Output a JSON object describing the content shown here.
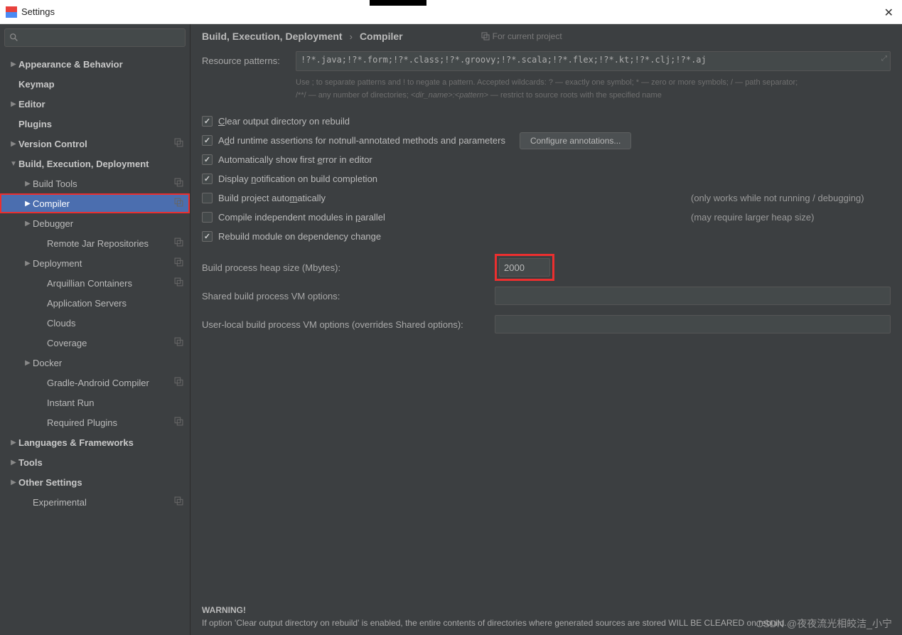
{
  "window": {
    "title": "Settings"
  },
  "sidebar": {
    "search_placeholder": "",
    "items": [
      {
        "label": "Appearance & Behavior",
        "depth": 0,
        "arrow": "▶",
        "bold": true
      },
      {
        "label": "Keymap",
        "depth": 0,
        "arrow": "",
        "bold": true
      },
      {
        "label": "Editor",
        "depth": 0,
        "arrow": "▶",
        "bold": true
      },
      {
        "label": "Plugins",
        "depth": 0,
        "arrow": "",
        "bold": true
      },
      {
        "label": "Version Control",
        "depth": 0,
        "arrow": "▶",
        "bold": true,
        "copy": true
      },
      {
        "label": "Build, Execution, Deployment",
        "depth": 0,
        "arrow": "▼",
        "bold": true
      },
      {
        "label": "Build Tools",
        "depth": 1,
        "arrow": "▶",
        "copy": true
      },
      {
        "label": "Compiler",
        "depth": 1,
        "arrow": "▶",
        "selected": true,
        "highlighted": true,
        "copy": true
      },
      {
        "label": "Debugger",
        "depth": 1,
        "arrow": "▶"
      },
      {
        "label": "Remote Jar Repositories",
        "depth": 2,
        "arrow": "",
        "copy": true
      },
      {
        "label": "Deployment",
        "depth": 1,
        "arrow": "▶",
        "copy": true
      },
      {
        "label": "Arquillian Containers",
        "depth": 2,
        "arrow": "",
        "copy": true
      },
      {
        "label": "Application Servers",
        "depth": 2,
        "arrow": ""
      },
      {
        "label": "Clouds",
        "depth": 2,
        "arrow": ""
      },
      {
        "label": "Coverage",
        "depth": 2,
        "arrow": "",
        "copy": true
      },
      {
        "label": "Docker",
        "depth": 1,
        "arrow": "▶"
      },
      {
        "label": "Gradle-Android Compiler",
        "depth": 2,
        "arrow": "",
        "copy": true
      },
      {
        "label": "Instant Run",
        "depth": 2,
        "arrow": ""
      },
      {
        "label": "Required Plugins",
        "depth": 2,
        "arrow": "",
        "copy": true
      },
      {
        "label": "Languages & Frameworks",
        "depth": 0,
        "arrow": "▶",
        "bold": true
      },
      {
        "label": "Tools",
        "depth": 0,
        "arrow": "▶",
        "bold": true
      },
      {
        "label": "Other Settings",
        "depth": 0,
        "arrow": "▶",
        "bold": true
      },
      {
        "label": "Experimental",
        "depth": 1,
        "arrow": "",
        "copy": true
      }
    ]
  },
  "breadcrumb": {
    "a": "Build, Execution, Deployment",
    "sep": "›",
    "b": "Compiler",
    "scope": "For current project"
  },
  "panel": {
    "resource_label": "Resource patterns:",
    "resource_value": "!?*.java;!?*.form;!?*.class;!?*.groovy;!?*.scala;!?*.flex;!?*.kt;!?*.clj;!?*.aj",
    "hint_a": "Use ; to separate patterns and ! to negate a pattern. Accepted wildcards: ? — exactly one symbol; * — zero or more symbols; / — path separator;",
    "hint_b_pre": "/**/ — any number of directories; ",
    "hint_b_i": "<dir_name>:<pattern>",
    "hint_b_post": " — restrict to source roots with the specified name",
    "checks": [
      {
        "checked": true,
        "label_pre": "",
        "label_u": "C",
        "label_post": "lear output directory on rebuild"
      },
      {
        "checked": true,
        "label_pre": "A",
        "label_u": "d",
        "label_post": "d runtime assertions for notnull-annotated methods and parameters",
        "btn": "Configure annotations..."
      },
      {
        "checked": true,
        "label_pre": "Automatically show first ",
        "label_u": "e",
        "label_post": "rror in editor"
      },
      {
        "checked": true,
        "label_pre": "Display ",
        "label_u": "n",
        "label_post": "otification on build completion"
      },
      {
        "checked": false,
        "label_pre": "Build project auto",
        "label_u": "m",
        "label_post": "atically",
        "note": "(only works while not running / debugging)"
      },
      {
        "checked": false,
        "label_pre": "Compile independent modules in ",
        "label_u": "p",
        "label_post": "arallel",
        "note": "(may require larger heap size)"
      },
      {
        "checked": true,
        "label_pre": "Rebuild module on dependency chan",
        "label_u": "g",
        "label_post": "e"
      }
    ],
    "heap_label": "Build process heap size (Mbytes):",
    "heap_value": "2000",
    "shared_label": "Shared build process VM options:",
    "shared_value": "",
    "user_label": "User-local build process VM options (overrides Shared options):",
    "user_value": "",
    "warning_title": "WARNING!",
    "warning_body": "If option 'Clear output directory on rebuild' is enabled, the entire contents of directories where generated sources are stored WILL BE CLEARED on rebuild."
  },
  "watermark": "CSDN @夜夜流光相皎洁_小宁"
}
